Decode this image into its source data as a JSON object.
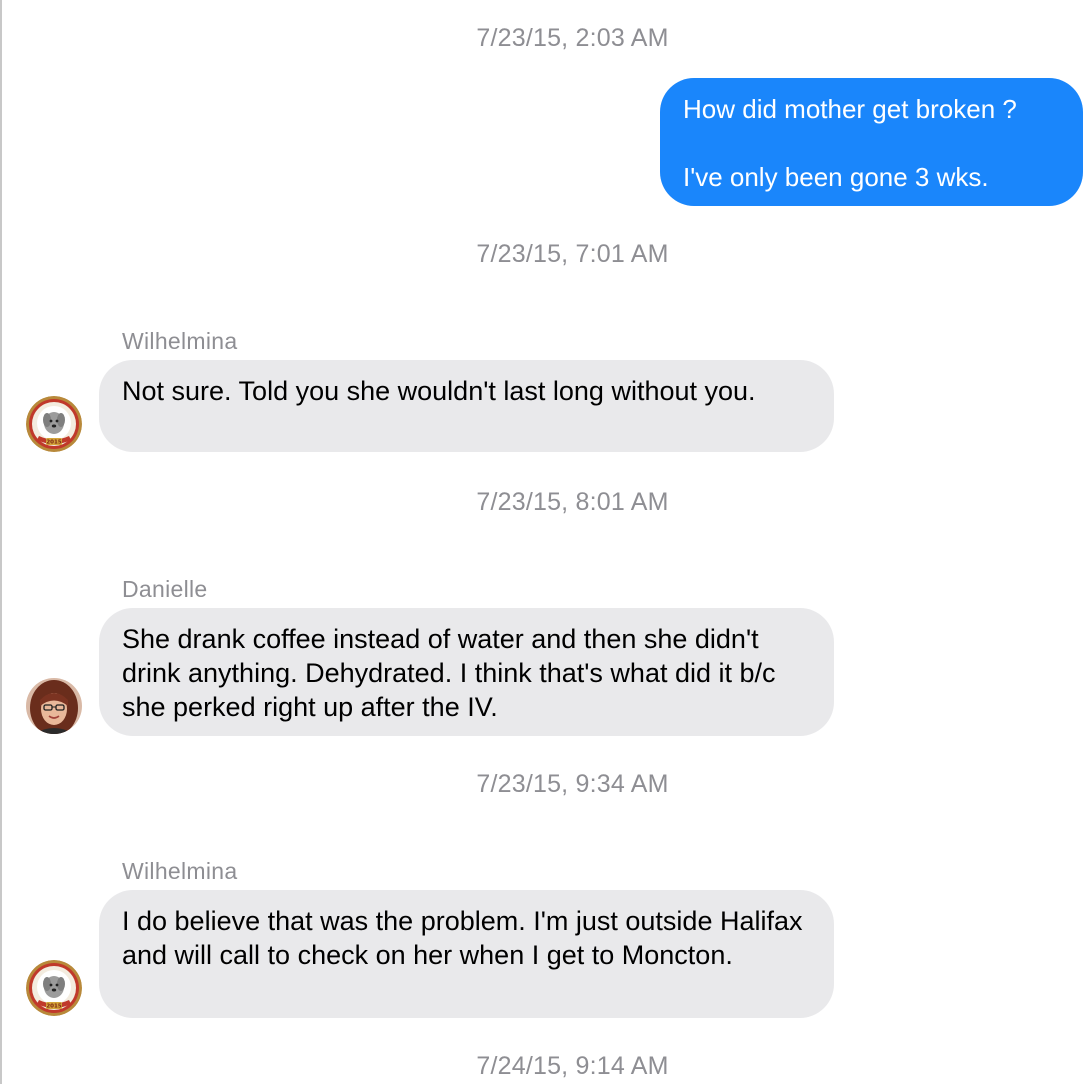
{
  "conversation": {
    "messages": [
      {
        "timestamp": "7/23/15, 2:03 AM",
        "direction": "outgoing",
        "lines": [
          "How did mother get broken ?",
          "I've only been gone 3 wks."
        ]
      },
      {
        "timestamp": "7/23/15, 7:01 AM",
        "direction": "incoming",
        "sender": "Wilhelmina",
        "avatar": "seal-dog-avatar-icon",
        "text": "Not sure. Told you she wouldn't last long without you."
      },
      {
        "timestamp": "7/23/15, 8:01 AM",
        "direction": "incoming",
        "sender": "Danielle",
        "avatar": "person-photo-avatar-icon",
        "text": "She drank coffee instead of water and then she didn't drink anything. Dehydrated. I think that's what did it b/c she perked right up after the IV."
      },
      {
        "timestamp": "7/23/15, 9:34 AM",
        "direction": "incoming",
        "sender": "Wilhelmina",
        "avatar": "seal-dog-avatar-icon",
        "text": "I do believe that was the problem. I'm just outside Halifax and will call to check on her when I get to Moncton."
      }
    ],
    "last_timestamp": "7/24/15, 9:14 AM"
  },
  "avatar_badges": {
    "seal_year": "2015"
  },
  "colors": {
    "outgoing_bubble": "#1a86fb",
    "incoming_bubble": "#e9e9eb",
    "timestamp_text": "#8e8e93"
  }
}
